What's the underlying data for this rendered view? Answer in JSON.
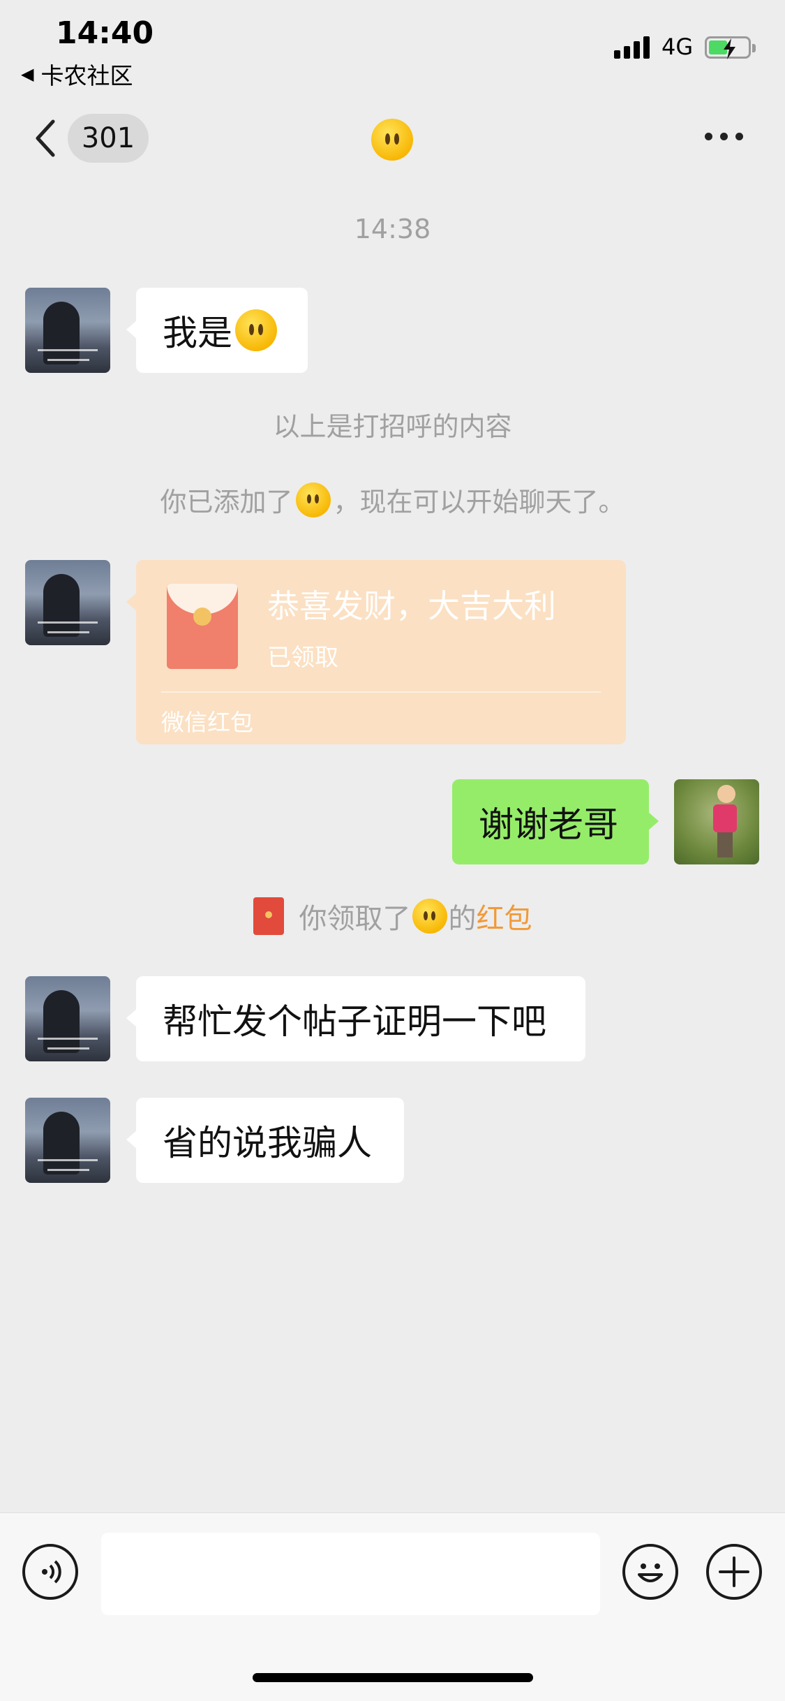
{
  "status_bar": {
    "time": "14:40",
    "back_app": "卡农社区",
    "network": "4G"
  },
  "nav": {
    "unread_count": "301",
    "title_icon": "neutral-face-emoji",
    "more_icon": "more-dots-icon"
  },
  "chat": {
    "timestamp": "14:38",
    "messages": [
      {
        "from": "contact",
        "text_before": "我是"
      },
      {
        "from": "contact",
        "type": "red_packet"
      },
      {
        "from": "me",
        "text": "谢谢老哥"
      },
      {
        "from": "contact",
        "text": "帮忙发个帖子证明一下吧"
      },
      {
        "from": "contact",
        "text": "省的说我骗人"
      }
    ],
    "system_greeting": "以上是打招呼的内容",
    "system_added_before": "你已添加了",
    "system_added_after": "，现在可以开始聊天了。",
    "red_packet": {
      "title": "恭喜发财，大吉大利",
      "status": "已领取",
      "footer": "微信红包"
    },
    "claimed_before": "你领取了",
    "claimed_mid": "的",
    "claimed_link": "红包"
  },
  "input_bar": {
    "voice_icon": "voice-icon",
    "emoji_icon": "emoji-icon",
    "plus_icon": "plus-icon",
    "text": ""
  },
  "colors": {
    "background": "#ededed",
    "my_bubble": "#95ec69",
    "red_packet_bg": "#fbe0c3",
    "link": "#f19a38"
  }
}
